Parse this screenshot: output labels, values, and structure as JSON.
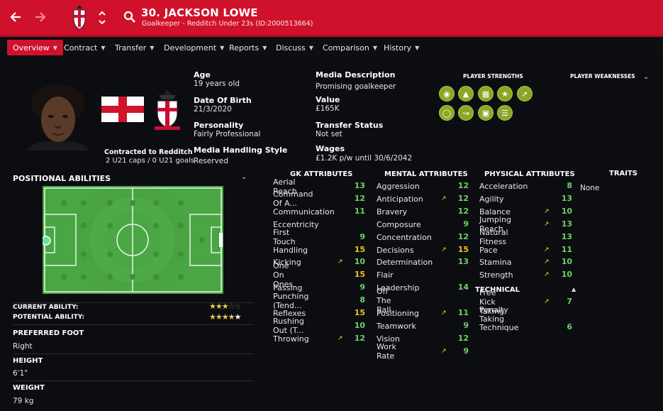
{
  "header": {
    "player_name": "30. JACKSON LOWE",
    "player_sub": "Goalkeeper - Redditch Under 23s (ID:2000513664)",
    "back_icon": "arrow-left-icon",
    "forward_icon": "arrow-right-icon",
    "search_icon": "search-icon",
    "accent": "#d0112b"
  },
  "menu": [
    {
      "label": "Overview",
      "active": true
    },
    {
      "label": "Contract"
    },
    {
      "label": "Transfer"
    },
    {
      "label": "Development"
    },
    {
      "label": "Reports"
    },
    {
      "label": "Discuss"
    },
    {
      "label": "Comparison"
    },
    {
      "label": "History"
    }
  ],
  "profile": {
    "contract_line1": "Contracted to Redditch",
    "contract_line2": "2 U21 caps / 0 U21 goals"
  },
  "details": {
    "age_label": "Age",
    "age_value": "19 years old",
    "dob_label": "Date Of Birth",
    "dob_value": "21/3/2020",
    "personality_label": "Personality",
    "personality_value": "Fairly Professional",
    "media_style_label": "Media Handling Style",
    "media_style_value": "Reserved",
    "media_desc_label": "Media Description",
    "media_desc_value": "Promising goalkeeper",
    "value_label": "Value",
    "value_value": "£165K",
    "transfer_label": "Transfer Status",
    "transfer_value": "Not set",
    "wages_label": "Wages",
    "wages_value": "£1.2K p/w until 30/6/2042"
  },
  "strengths": {
    "title": "PLAYER STRENGTHS",
    "weakness_title": "PLAYER WEAKNESSES",
    "icons": [
      "goalkeeper-icon",
      "flask-icon",
      "clipboard-icon",
      "star-icon",
      "trend-up-icon",
      "head-icon",
      "running-icon",
      "pitch-icon",
      "notes-icon"
    ]
  },
  "positional": {
    "title": "POSITIONAL ABILITIES",
    "current_label": "CURRENT ABILITY:",
    "potential_label": "POTENTIAL ABILITY:",
    "current_stars": 3,
    "potential_stars": 4.5
  },
  "info": {
    "foot_label": "PREFERRED FOOT",
    "foot_value": "Right",
    "height_label": "HEIGHT",
    "height_value": "6'1\"",
    "weight_label": "WEIGHT",
    "weight_value": "79 kg"
  },
  "gk": {
    "title": "GK ATTRIBUTES",
    "rows": [
      {
        "name": "Aerial Reach",
        "value": "13"
      },
      {
        "name": "Command Of A...",
        "value": "12"
      },
      {
        "name": "Communication",
        "value": "11"
      },
      {
        "name": "Eccentricity",
        "value": ""
      },
      {
        "name": "First Touch",
        "value": "9"
      },
      {
        "name": "Handling",
        "value": "15"
      },
      {
        "name": "Kicking",
        "value": "10",
        "arrow": true
      },
      {
        "name": "One On Ones",
        "value": "15"
      },
      {
        "name": "Passing",
        "value": "9"
      },
      {
        "name": "Punching (Tend...",
        "value": "8"
      },
      {
        "name": "Reflexes",
        "value": "15"
      },
      {
        "name": "Rushing Out (T...",
        "value": "10"
      },
      {
        "name": "Throwing",
        "value": "12",
        "arrow": true
      }
    ]
  },
  "mental": {
    "title": "MENTAL ATTRIBUTES",
    "rows": [
      {
        "name": "Aggression",
        "value": "12"
      },
      {
        "name": "Anticipation",
        "value": "12",
        "arrow": true
      },
      {
        "name": "Bravery",
        "value": "12"
      },
      {
        "name": "Composure",
        "value": "9"
      },
      {
        "name": "Concentration",
        "value": "12"
      },
      {
        "name": "Decisions",
        "value": "15",
        "arrow": true
      },
      {
        "name": "Determination",
        "value": "13"
      },
      {
        "name": "Flair",
        "value": ""
      },
      {
        "name": "Leadership",
        "value": "14"
      },
      {
        "name": "Off The Ball",
        "value": ""
      },
      {
        "name": "Positioning",
        "value": "11",
        "arrow": true
      },
      {
        "name": "Teamwork",
        "value": "9"
      },
      {
        "name": "Vision",
        "value": "12"
      },
      {
        "name": "Work Rate",
        "value": "9",
        "arrow": true
      }
    ]
  },
  "physical": {
    "title": "PHYSICAL ATTRIBUTES",
    "rows": [
      {
        "name": "Acceleration",
        "value": "8"
      },
      {
        "name": "Agility",
        "value": "13"
      },
      {
        "name": "Balance",
        "value": "10",
        "arrow": true
      },
      {
        "name": "Jumping Reach",
        "value": "13",
        "arrow": true
      },
      {
        "name": "Natural Fitness",
        "value": "13"
      },
      {
        "name": "Pace",
        "value": "11",
        "arrow": true
      },
      {
        "name": "Stamina",
        "value": "10",
        "arrow": true
      },
      {
        "name": "Strength",
        "value": "10",
        "arrow": true
      }
    ],
    "technical_title": "TECHNICAL",
    "technical_rows": [
      {
        "name": "Free Kick Taking",
        "value": "7",
        "arrow": true
      },
      {
        "name": "Penalty Taking",
        "value": ""
      },
      {
        "name": "Technique",
        "value": "6"
      }
    ]
  },
  "traits": {
    "title": "TRAITS",
    "value": "None"
  }
}
